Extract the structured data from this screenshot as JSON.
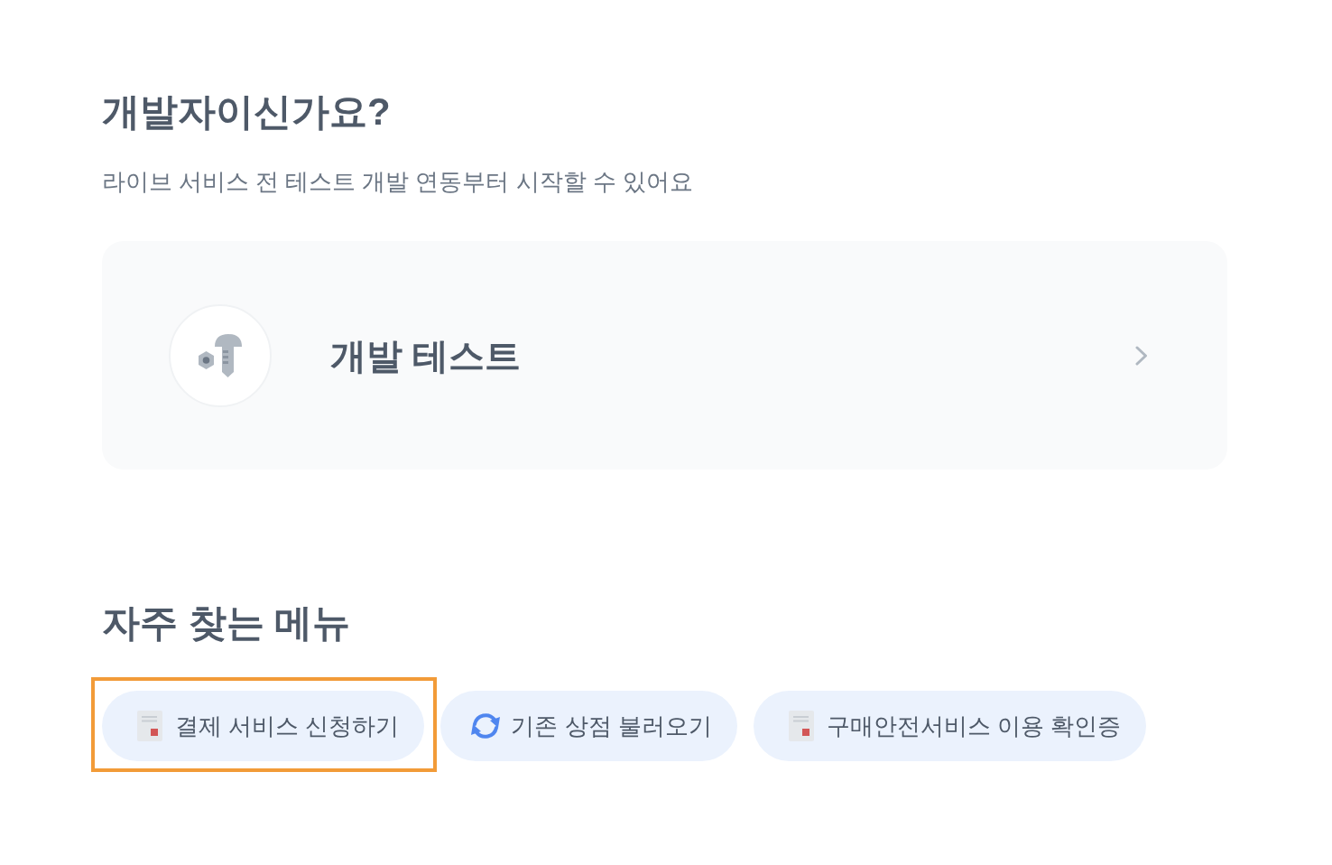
{
  "developer_section": {
    "title": "개발자이신가요?",
    "subtitle": "라이브 서비스 전 테스트 개발 연동부터 시작할 수 있어요",
    "card": {
      "title": "개발 테스트"
    }
  },
  "quick_menu": {
    "title": "자주 찾는 메뉴",
    "items": [
      {
        "label": "결제 서비스 신청하기",
        "kind": "document",
        "highlighted": true
      },
      {
        "label": "기존 상점 불러오기",
        "kind": "refresh",
        "highlighted": false
      },
      {
        "label": "구매안전서비스 이용 확인증",
        "kind": "document",
        "highlighted": false
      }
    ]
  }
}
